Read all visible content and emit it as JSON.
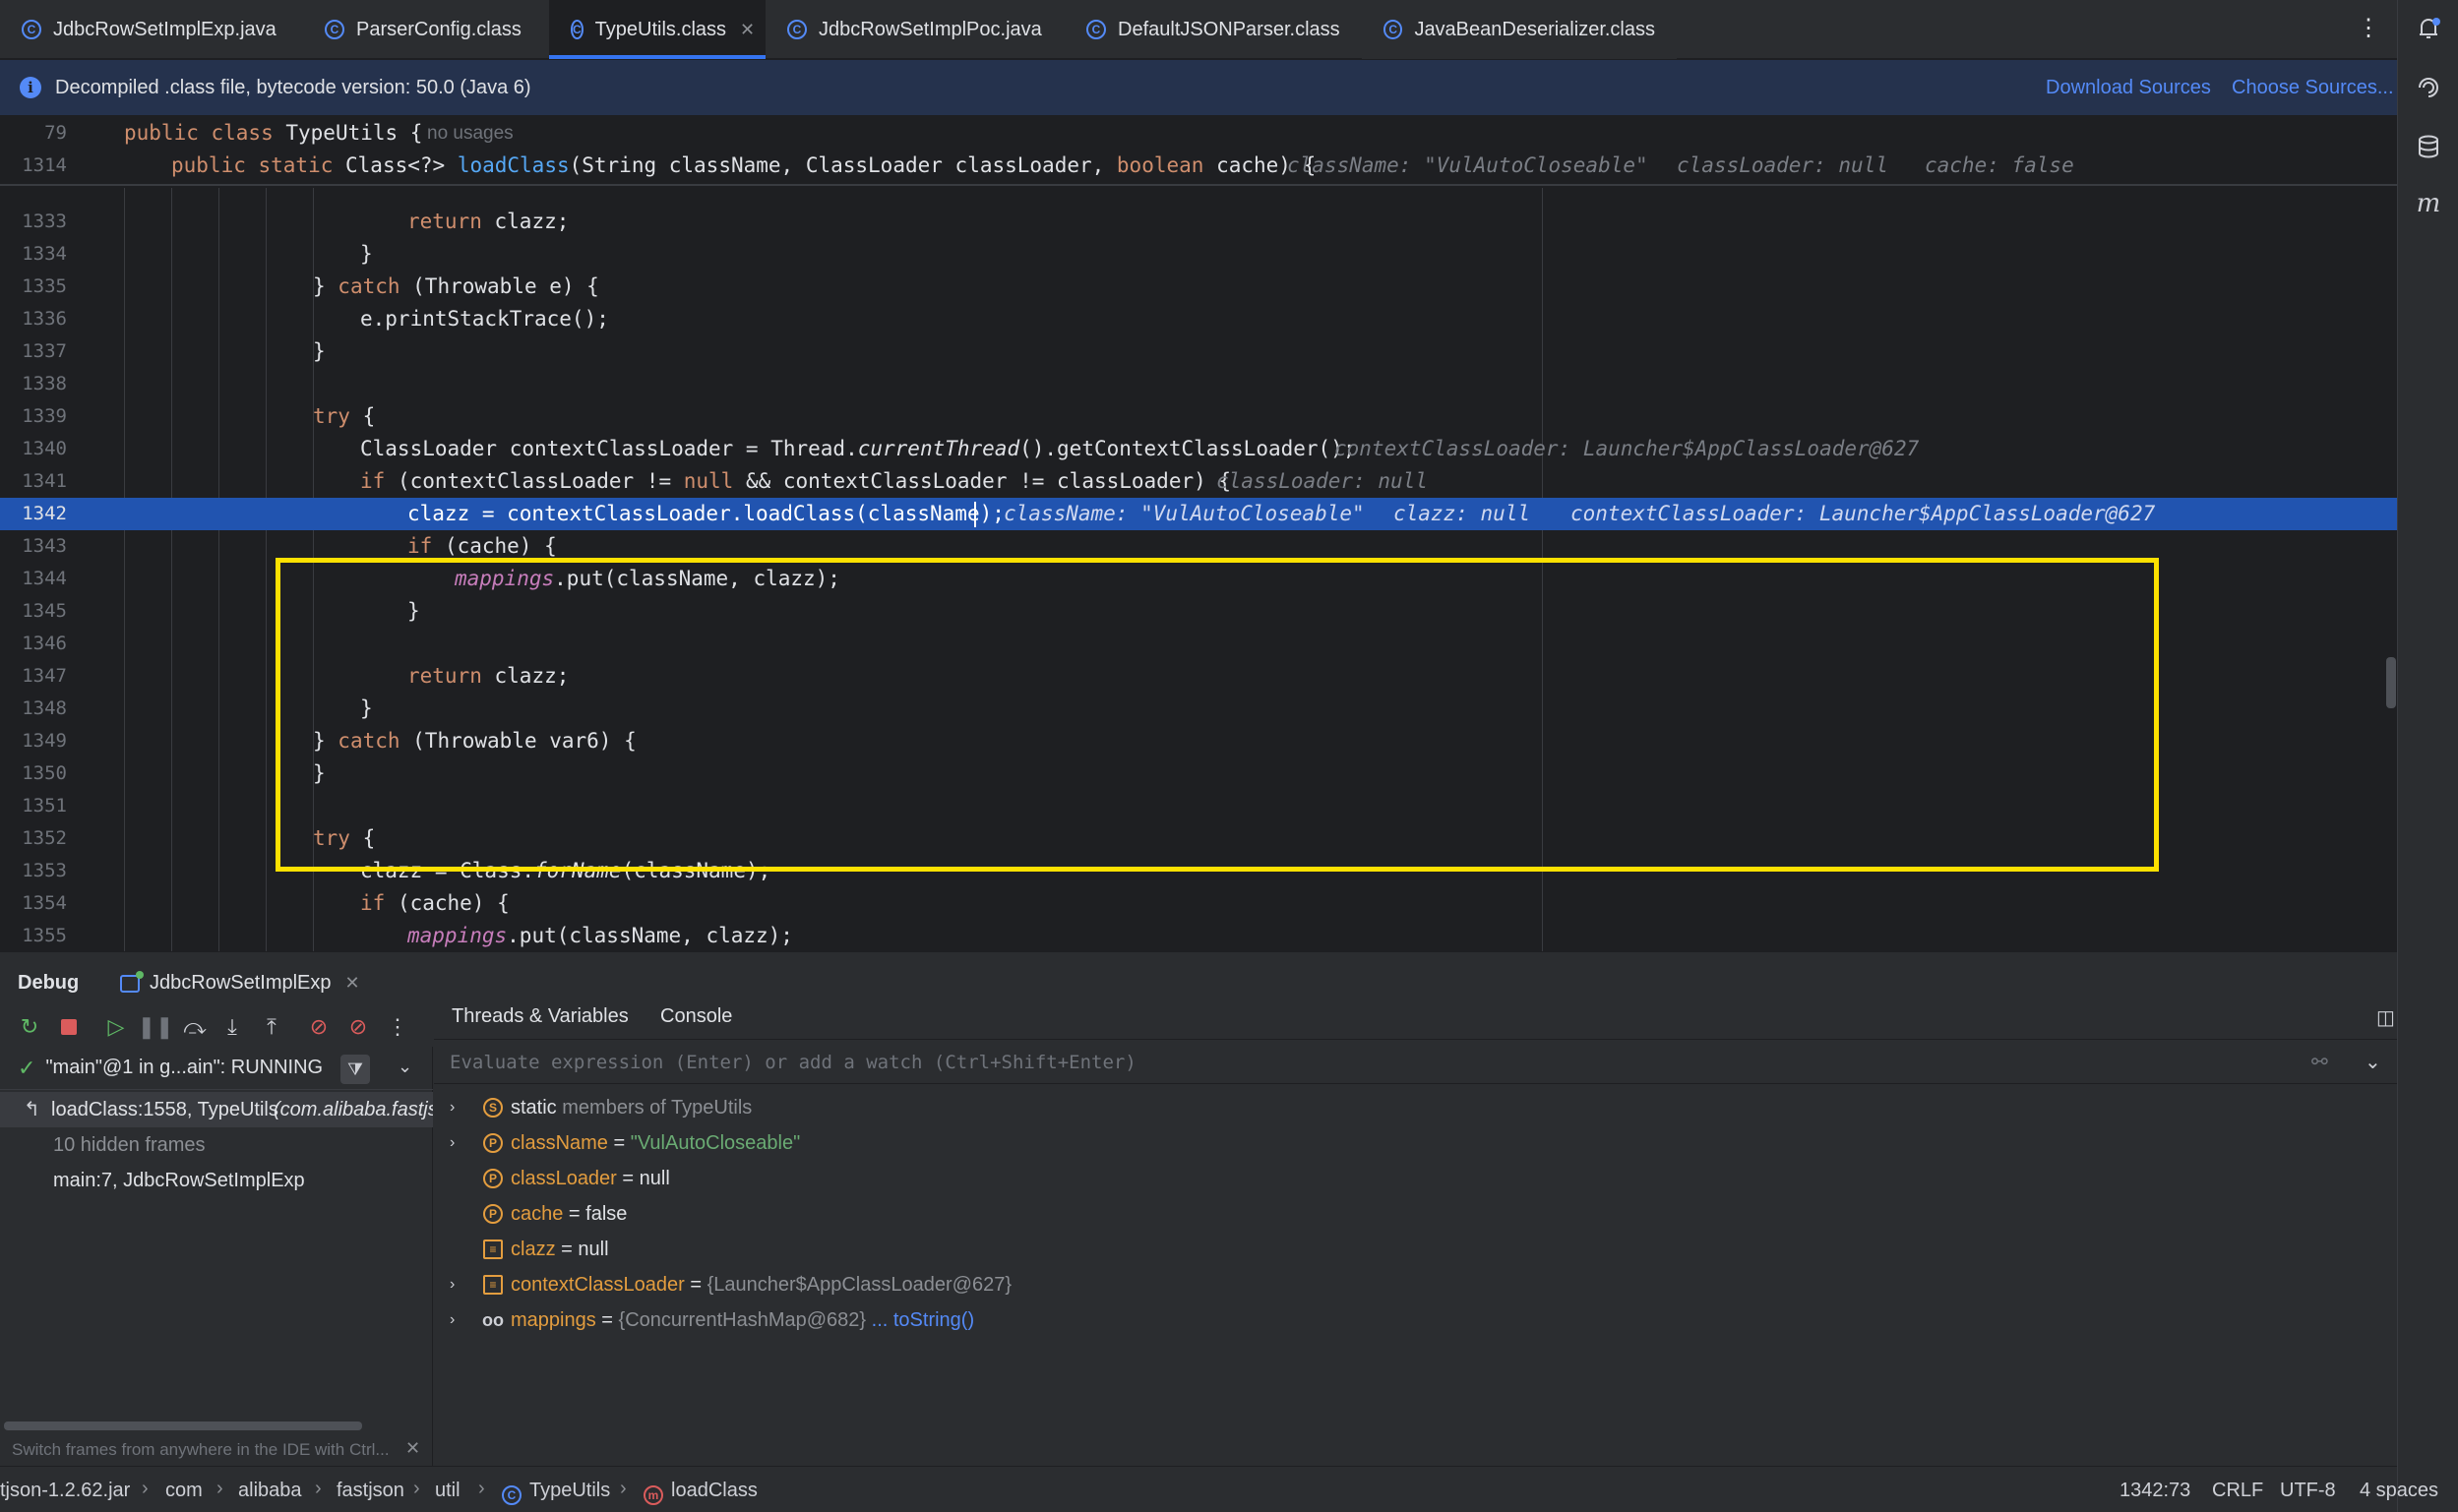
{
  "tabs": [
    {
      "label": "JdbcRowSetImplExp.java"
    },
    {
      "label": "ParserConfig.class"
    },
    {
      "label": "TypeUtils.class",
      "active": true
    },
    {
      "label": "JdbcRowSetImplPoc.java"
    },
    {
      "label": "DefaultJSONParser.class"
    },
    {
      "label": "JavaBeanDeserializer.class"
    }
  ],
  "banner": {
    "text": "Decompiled .class file, bytecode version: 50.0 (Java 6)",
    "download_sources": "Download Sources",
    "choose_sources": "Choose Sources..."
  },
  "sticky": {
    "line1_num": "79",
    "line1_code": "public class TypeUtils {",
    "line1_hint": "no usages",
    "line2_num": "1314",
    "line2_hint_classname": "className: \"VulAutoCloseable\"",
    "line2_hint_classloader": "classLoader: null",
    "line2_hint_cache": "cache: false"
  },
  "code": {
    "current_line": "1342",
    "hint_context": "contextClassLoader: Launcher$AppClassLoader@627",
    "hint_loader": "classLoader: null",
    "hint_classname": "className: \"VulAutoCloseable\"",
    "hint_clazz": "clazz: null"
  },
  "debug": {
    "title": "Debug",
    "session": "JdbcRowSetImplExp",
    "thread": "\"main\"@1 in g...ain\": RUNNING",
    "frames": [
      {
        "label": "loadClass:1558, TypeUtils",
        "pkg": "(com.alibaba.fastjs"
      },
      {
        "label": "10 hidden frames"
      },
      {
        "label": "main:7, JdbcRowSetImplExp"
      }
    ],
    "tip": "Switch frames from anywhere in the IDE with Ctrl...",
    "subtabs": [
      "Threads & Variables",
      "Console"
    ],
    "eval_placeholder": "Evaluate expression (Enter) or add a watch (Ctrl+Shift+Enter)",
    "variables": [
      {
        "name": "static",
        "value": "members of TypeUtils"
      },
      {
        "name": "className",
        "eq": " = ",
        "value": "\"VulAutoCloseable\""
      },
      {
        "name": "classLoader",
        "eq": " = ",
        "value": "null"
      },
      {
        "name": "cache",
        "eq": " = ",
        "value": "false"
      },
      {
        "name": "clazz",
        "eq": " = ",
        "value": "null"
      },
      {
        "name": "contextClassLoader",
        "eq": " = ",
        "value": "{Launcher$AppClassLoader@627}"
      },
      {
        "name": "mappings",
        "eq": " = ",
        "value": "{ConcurrentHashMap@682}",
        "link": "... toString()"
      }
    ]
  },
  "status": {
    "crumbs": [
      "tjson-1.2.62.jar",
      "com",
      "alibaba",
      "fastjson",
      "util",
      "TypeUtils",
      "loadClass"
    ],
    "position": "1342:73",
    "line_sep": "CRLF",
    "encoding": "UTF-8",
    "indent": "4 spaces"
  }
}
